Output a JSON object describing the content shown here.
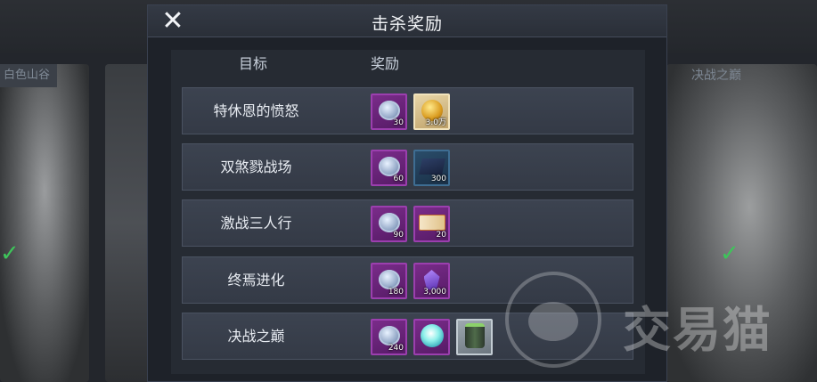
{
  "background": {
    "left_label": "白色山谷",
    "right_label": "决战之巅"
  },
  "panel": {
    "title": "击杀奖励",
    "columns": {
      "goal": "目标",
      "reward": "奖励"
    },
    "rows": [
      {
        "name": "特休恩的愤怒",
        "rewards": [
          {
            "icon": "silver-coin-icon",
            "qty": "30"
          },
          {
            "icon": "gold-coin-icon",
            "qty": "3.0万"
          }
        ]
      },
      {
        "name": "双煞戮战场",
        "rewards": [
          {
            "icon": "silver-coin-icon",
            "qty": "60"
          },
          {
            "icon": "blue-cube-icon",
            "qty": "300"
          }
        ]
      },
      {
        "name": "激战三人行",
        "rewards": [
          {
            "icon": "silver-coin-icon",
            "qty": "90"
          },
          {
            "icon": "ticket-icon",
            "qty": "20"
          }
        ]
      },
      {
        "name": "终焉进化",
        "rewards": [
          {
            "icon": "silver-coin-icon",
            "qty": "180"
          },
          {
            "icon": "purple-crystal-icon",
            "qty": "3,000"
          }
        ]
      },
      {
        "name": "决战之巅",
        "rewards": [
          {
            "icon": "silver-coin-icon",
            "qty": "240"
          },
          {
            "icon": "cyan-gem-icon",
            "qty": ""
          },
          {
            "icon": "canister-icon",
            "qty": ""
          }
        ]
      }
    ]
  },
  "watermark": {
    "text": "交易猫"
  },
  "colors": {
    "purple_frame": "#7a2c8a",
    "panel_bg": "#1e2229",
    "row_bg": "#3c4350"
  }
}
